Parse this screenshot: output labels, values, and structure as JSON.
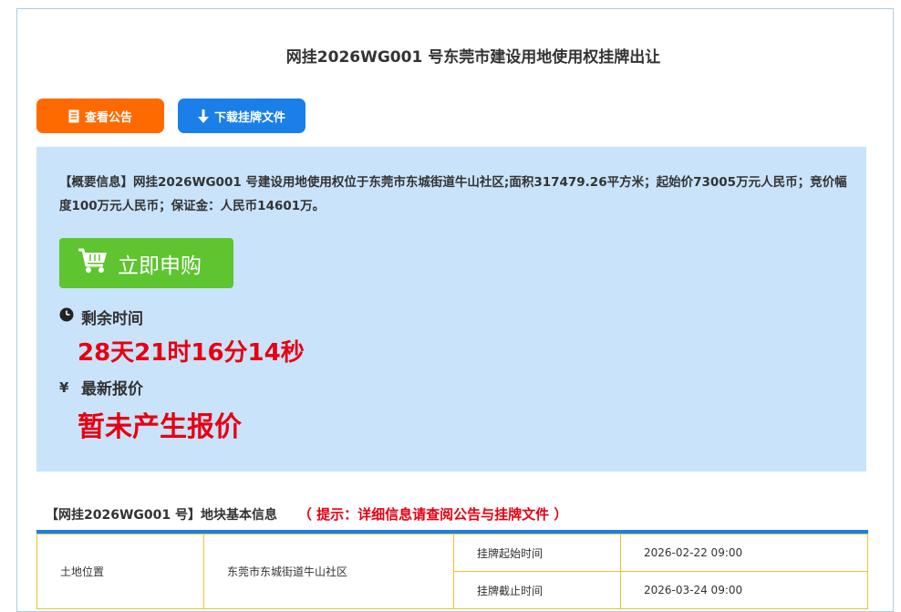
{
  "page": {
    "title": "网挂2026WG001 号东莞市建设用地使用权挂牌出让"
  },
  "toolbar": {
    "notice_label": "查看公告",
    "download_label": "下载挂牌文件"
  },
  "summary": {
    "text": "【概要信息】网挂2026WG001 号建设用地使用权位于东莞市东城街道牛山社区;面积317479.26平方米；起始价73005万元人民币；竞价幅度100万元人民币；保证金：人民币14601万。"
  },
  "buy": {
    "label": "立即申购"
  },
  "remaining": {
    "label": "剩余时间",
    "value": "28天21时16分14秒"
  },
  "price": {
    "symbol": "¥",
    "label": "最新报价",
    "value": "暂未产生报价"
  },
  "section": {
    "title": "【网挂2026WG001 号】地块基本信息",
    "hint": "（ 提示：详细信息请查阅公告与挂牌文件 ）"
  },
  "table": {
    "rows": [
      {
        "k1": "土地位置",
        "v1": "东莞市东城街道牛山社区",
        "k2": "挂牌起始时间",
        "v2": "2026-02-22 09:00"
      },
      {
        "k2": "挂牌截止时间",
        "v2": "2026-03-24 09:00"
      }
    ]
  },
  "colors": {
    "accent_blue": "#1a7fe8",
    "accent_orange": "#ff6a00",
    "buy_green": "#5ec430",
    "panel_bg": "#c9e3fa",
    "alert_red": "#e60012"
  }
}
